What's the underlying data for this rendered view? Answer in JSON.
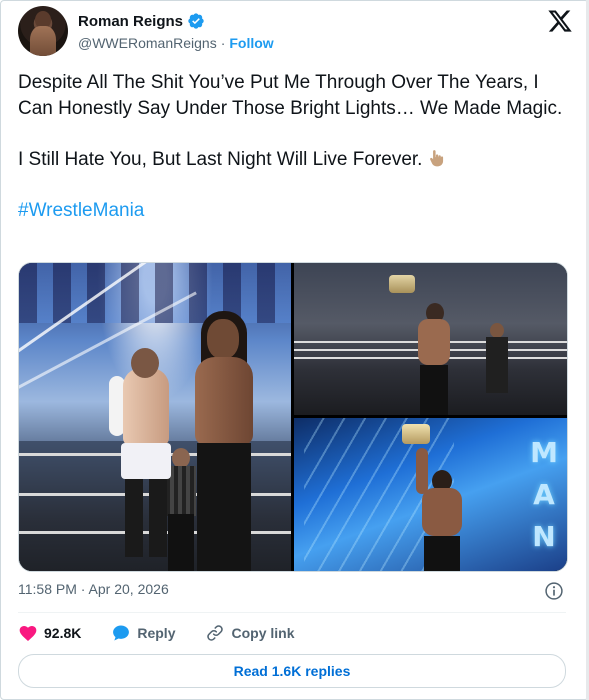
{
  "author": {
    "display_name": "Roman Reigns",
    "handle": "@WWERomanReigns",
    "separator": "·",
    "follow_label": "Follow",
    "verified_icon": "verified-badge-icon"
  },
  "platform_icon": "x-logo-icon",
  "tweet": {
    "paragraph_1": "Despite All The Shit You’ve Put Me Through Over The Years, I Can Honestly Say Under Those Bright Lights… We Made Magic.",
    "paragraph_2": "I Still Hate You, But Last Night Will Live Forever.",
    "emoji_icon": "pointing-up-hand-icon",
    "hashtag": "#WrestleMania"
  },
  "media": {
    "images": [
      "wrestlers-face-off-photo",
      "champion-celebration-ring-photo",
      "champion-raising-title-photo"
    ],
    "stage_text": "MAN"
  },
  "timestamp": "11:58 PM · Apr 20, 2026",
  "actions": {
    "likes": "92.8K",
    "reply_label": "Reply",
    "copy_link_label": "Copy link"
  },
  "read_replies_label": "Read 1.6K replies",
  "colors": {
    "accent": "#1d9bf0",
    "like": "#f91880",
    "text": "#0f1419",
    "muted": "#536471"
  }
}
